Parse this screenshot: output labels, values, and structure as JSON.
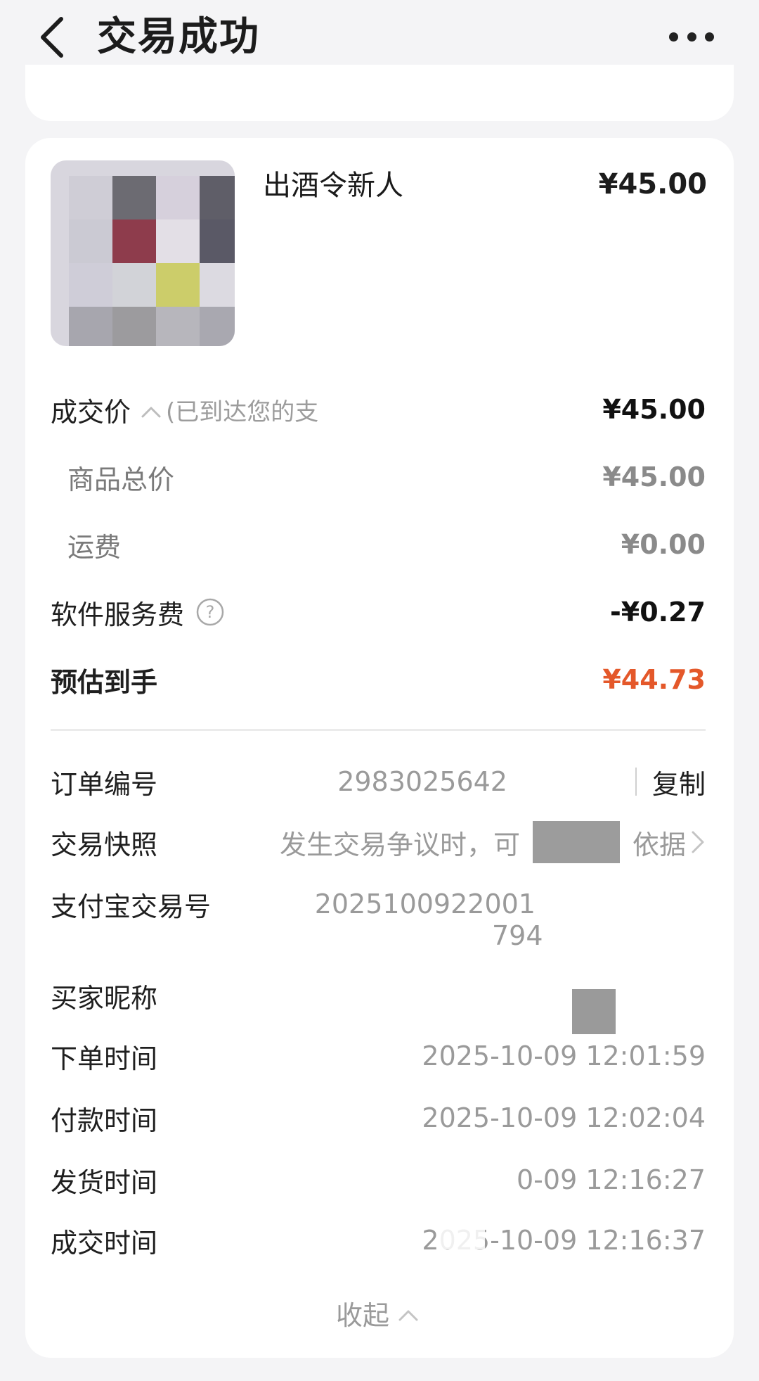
{
  "header": {
    "title": "交易成功",
    "back_icon": "chevron-left-icon",
    "more_icon": "more-horizontal-icon"
  },
  "product": {
    "name": "出酒令新人",
    "price": "¥45.00"
  },
  "price_rows": {
    "deal_price": {
      "label": "成交价",
      "hint": "(已到达您的支",
      "value": "¥45.00"
    },
    "goods_total": {
      "label": "商品总价",
      "value": "¥45.00"
    },
    "shipping": {
      "label": "运费",
      "value": "¥0.00"
    },
    "service_fee": {
      "label": "软件服务费",
      "value": "-¥0.27"
    },
    "estimated": {
      "label": "预估到手",
      "value": "¥44.73"
    }
  },
  "info_rows": {
    "order_no": {
      "label": "订单编号",
      "value": "2983025642",
      "copy": "复制"
    },
    "snapshot": {
      "label": "交易快照",
      "value": "发生交易争议时，可",
      "value_tail": "依据"
    },
    "alipay_no": {
      "label": "支付宝交易号",
      "value": "2025100922001",
      "value_line2": "794"
    },
    "buyer_nick": {
      "label": "买家昵称",
      "value": ""
    },
    "order_time": {
      "label": "下单时间",
      "value": "2025-10-09 12:01:59"
    },
    "pay_time": {
      "label": "付款时间",
      "value": "2025-10-09 12:02:04"
    },
    "ship_time": {
      "label": "发货时间",
      "value": "0-09 12:16:27"
    },
    "deal_time": {
      "label": "成交时间",
      "value": "2025-10-09 12:16:37"
    }
  },
  "collapse_label": "收起",
  "colors": {
    "accent_orange": "#e4582a",
    "background": "#f4f4f6",
    "card": "#ffffff",
    "muted_text": "#9a9a9a"
  }
}
